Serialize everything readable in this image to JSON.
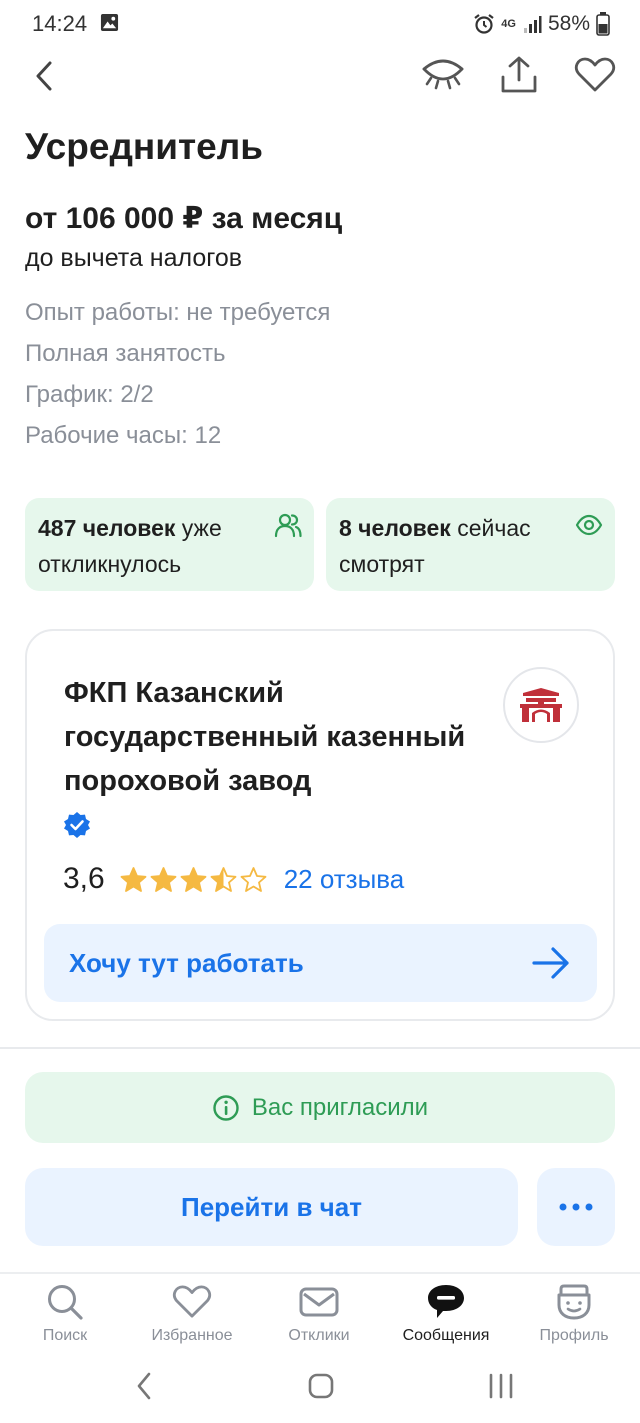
{
  "status_bar": {
    "time": "14:24",
    "battery": "58%",
    "network": "4G"
  },
  "vacancy": {
    "title": "Усреднитель",
    "salary": "от 106 000 ₽ за месяц",
    "tax_note": "до вычета налогов",
    "details": [
      "Опыт работы: не требуется",
      "Полная занятость",
      "График: 2/2",
      "Рабочие часы: 12"
    ]
  },
  "stats": {
    "responded_count": "487 человек",
    "responded_rest": " уже откликнулось",
    "watching_count": "8 человек",
    "watching_rest": " сейчас смотрят"
  },
  "employer": {
    "name": "ФКП Казанский государственный казенный пороховой завод",
    "rating": "3,6",
    "rating_value": 3.5,
    "stars_max": 5,
    "reviews": "22 отзыва",
    "want_work_label": "Хочу тут работать"
  },
  "actions": {
    "invited_label": "Вас пригласили",
    "chat_label": "Перейти в чат"
  },
  "tabs": [
    {
      "label": "Поиск",
      "icon": "search-icon"
    },
    {
      "label": "Избранное",
      "icon": "heart-icon"
    },
    {
      "label": "Отклики",
      "icon": "envelope-icon"
    },
    {
      "label": "Сообщения",
      "icon": "chat-bubble-icon"
    },
    {
      "label": "Профиль",
      "icon": "profile-icon"
    }
  ],
  "colors": {
    "accent": "#1a73e8",
    "green_bg": "#e6f7ec",
    "green_text": "#2e9c55",
    "blue_bg": "#eaf3ff",
    "star": "#f5b942",
    "muted": "#8a8f98"
  }
}
